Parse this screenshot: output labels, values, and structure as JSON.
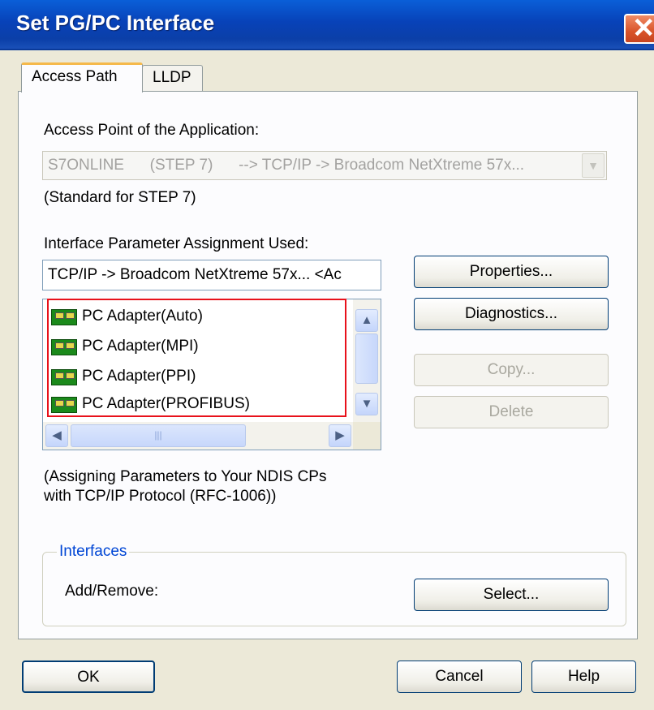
{
  "window": {
    "title": "Set PG/PC Interface"
  },
  "tabs": [
    {
      "label": "Access Path"
    },
    {
      "label": "LLDP"
    }
  ],
  "access_point": {
    "label": "Access Point of the Application:",
    "value": "S7ONLINE      (STEP 7)      --> TCP/IP -> Broadcom NetXtreme 57x...",
    "note": "(Standard for STEP 7)"
  },
  "interface_params": {
    "label": "Interface Parameter Assignment Used:",
    "value": "TCP/IP -> Broadcom NetXtreme 57x...  <Ac"
  },
  "list": {
    "items": [
      {
        "label": "PC Adapter(Auto)"
      },
      {
        "label": "PC Adapter(MPI)"
      },
      {
        "label": "PC Adapter(PPI)"
      },
      {
        "label": "PC Adapter(PROFIBUS)"
      }
    ]
  },
  "buttons": {
    "properties": "Properties...",
    "diagnostics": "Diagnostics...",
    "copy": "Copy...",
    "delete": "Delete",
    "select": "Select...",
    "ok": "OK",
    "cancel": "Cancel",
    "help": "Help"
  },
  "description": {
    "line1": "(Assigning Parameters to Your NDIS CPs",
    "line2": "with TCP/IP Protocol (RFC-1006))"
  },
  "interfaces": {
    "title": "Interfaces",
    "add_remove_label": "Add/Remove:"
  },
  "colors": {
    "titlebar": "#0842b8",
    "highlight": "#e8111b",
    "group_title": "#0046d5"
  }
}
